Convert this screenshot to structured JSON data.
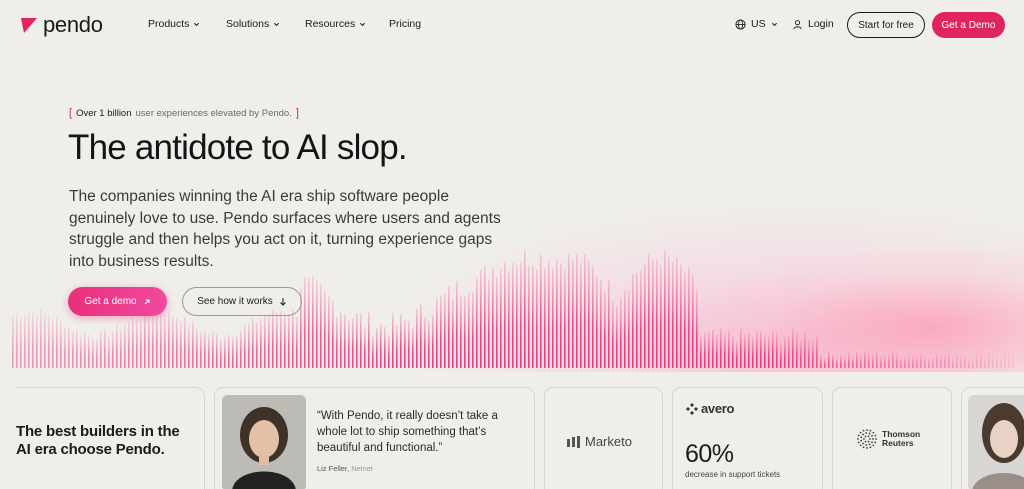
{
  "nav": {
    "logo": "pendo",
    "links": [
      {
        "label": "Products",
        "has_menu": true
      },
      {
        "label": "Solutions",
        "has_menu": true
      },
      {
        "label": "Resources",
        "has_menu": true
      },
      {
        "label": "Pricing",
        "has_menu": false
      }
    ],
    "region": "US",
    "login": "Login",
    "start_free": "Start for free",
    "get_demo": "Get a Demo"
  },
  "hero": {
    "tagline_open": "[",
    "tagline_strong": "Over 1 billion",
    "tagline_rest": "user experiences elevated by Pendo.",
    "tagline_close": "]",
    "title": "The antidote to AI slop.",
    "body": "The companies winning the AI era ship software people genuinely love to use. Pendo surfaces where users and agents struggle and then helps you act on it, turning experience gaps into business results.",
    "cta_demo": "Get a demo",
    "cta_how": "See how it works"
  },
  "proof": {
    "builders_line1": "The best builders in the",
    "builders_line2": "AI era choose Pendo.",
    "quote": "“With Pendo, it really doesn’t take a whole lot to ship something that’s beautiful and functional.”",
    "quote_author": "Liz Feller,",
    "quote_company": "Nelnet",
    "marketo": "Marketo",
    "avero_logo": "avero",
    "avero_stat": "60%",
    "avero_stat_label": "decrease in support tickets",
    "thomson_line1": "Thomson",
    "thomson_line2": "Reuters"
  },
  "colors": {
    "accent": "#e0245e",
    "background": "#efeeea"
  }
}
